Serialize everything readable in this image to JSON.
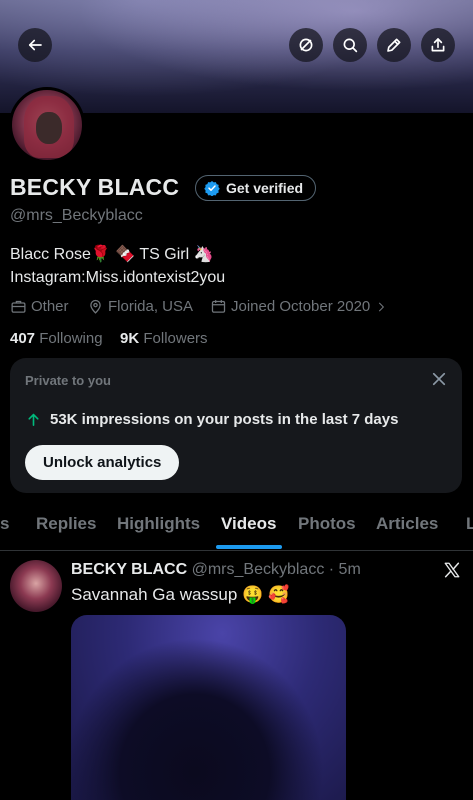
{
  "header": {
    "back_icon": "arrow-left-icon",
    "actions": [
      "grok-icon",
      "search-icon",
      "edit-icon",
      "share-icon"
    ]
  },
  "profile": {
    "name": "BECKY BLACC",
    "verify_label": "Get verified",
    "handle": "@mrs_Beckyblacc",
    "bio_line1": "Blacc Rose🌹 🍫 TS Girl 🦄",
    "bio_line2": "Instagram:Miss.idontexist2you",
    "category": "Other",
    "location": "Florida, USA",
    "joined": "Joined October 2020",
    "following_count": "407",
    "following_label": "Following",
    "followers_count": "9K",
    "followers_label": "Followers"
  },
  "analytics_card": {
    "private_label": "Private to you",
    "impressions_text": "53K impressions on your posts in the last 7 days",
    "unlock_label": "Unlock analytics"
  },
  "tabs": [
    {
      "label": "s"
    },
    {
      "label": "Replies"
    },
    {
      "label": "Highlights"
    },
    {
      "label": "Videos"
    },
    {
      "label": "Photos"
    },
    {
      "label": "Articles"
    },
    {
      "label": "L"
    }
  ],
  "active_tab": "Videos",
  "post": {
    "author": "BECKY BLACC",
    "handle_time": "@mrs_Beckyblacc · 5m",
    "text": "Savannah Ga wassup 🤑 🥰"
  },
  "colors": {
    "accent": "#1d9bf0",
    "verified": "#1d9bf0",
    "impressions_arrow": "#00ba7c"
  }
}
